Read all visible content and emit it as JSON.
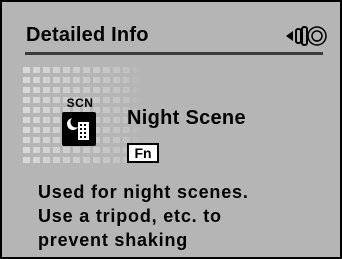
{
  "screen": {
    "title": "Detailed Info",
    "nav_icon": "left-right-dial-icon"
  },
  "mode": {
    "badge_label": "SCN",
    "icon": "night-scene-icon",
    "name": "Night Scene",
    "fn_label": "Fn"
  },
  "description": {
    "lines": [
      "Used for night scenes.",
      "Use a tripod, etc. to",
      "prevent shaking"
    ]
  },
  "colors": {
    "background": "#b5b5b5",
    "divider": "#3a3a3a",
    "text": "#000000"
  }
}
